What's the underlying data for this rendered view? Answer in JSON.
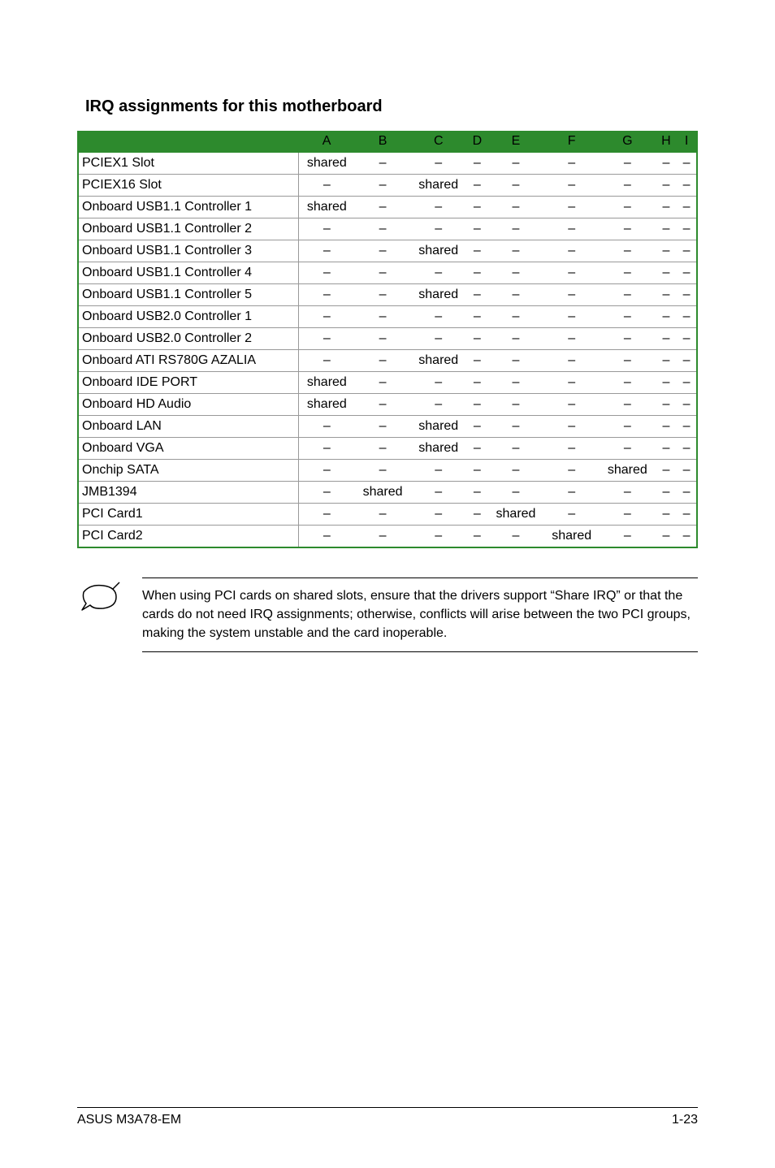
{
  "heading": "IRQ assignments for this motherboard",
  "columns": [
    "",
    "A",
    "B",
    "C",
    "D",
    "E",
    "F",
    "G",
    "H",
    "I"
  ],
  "rows": [
    {
      "label": "PCIEX1 Slot",
      "cells": [
        "shared",
        "–",
        "–",
        "–",
        "–",
        "–",
        "–",
        "–",
        "–"
      ]
    },
    {
      "label": "PCIEX16 Slot",
      "cells": [
        "–",
        "–",
        "shared",
        "–",
        "–",
        "–",
        "–",
        "–",
        "–"
      ]
    },
    {
      "label": "Onboard USB1.1 Controller 1",
      "cells": [
        "shared",
        "–",
        "–",
        "–",
        "–",
        "–",
        "–",
        "–",
        "–"
      ]
    },
    {
      "label": "Onboard USB1.1 Controller 2",
      "cells": [
        "–",
        "–",
        "–",
        "–",
        "–",
        "–",
        "–",
        "–",
        "–"
      ]
    },
    {
      "label": "Onboard USB1.1 Controller 3",
      "cells": [
        "–",
        "–",
        "shared",
        "–",
        "–",
        "–",
        "–",
        "–",
        "–"
      ]
    },
    {
      "label": "Onboard USB1.1 Controller 4",
      "cells": [
        "–",
        "–",
        "–",
        "–",
        "–",
        "–",
        "–",
        "–",
        "–"
      ]
    },
    {
      "label": "Onboard USB1.1 Controller 5",
      "cells": [
        "–",
        "–",
        "shared",
        "–",
        "–",
        "–",
        "–",
        "–",
        "–"
      ]
    },
    {
      "label": "Onboard USB2.0 Controller 1",
      "cells": [
        "–",
        "–",
        "–",
        "–",
        "–",
        "–",
        "–",
        "–",
        "–"
      ]
    },
    {
      "label": "Onboard USB2.0 Controller 2",
      "cells": [
        "–",
        "–",
        "–",
        "–",
        "–",
        "–",
        "–",
        "–",
        "–"
      ]
    },
    {
      "label": "Onboard ATI RS780G AZALIA",
      "cells": [
        "–",
        "–",
        "shared",
        "–",
        "–",
        "–",
        "–",
        "–",
        "–"
      ]
    },
    {
      "label": "Onboard  IDE  PORT",
      "cells": [
        "shared",
        "–",
        "–",
        "–",
        "–",
        "–",
        "–",
        "–",
        "–"
      ]
    },
    {
      "label": "Onboard  HD Audio",
      "cells": [
        "shared",
        "–",
        "–",
        "–",
        "–",
        "–",
        "–",
        "–",
        "–"
      ]
    },
    {
      "label": "Onboard  LAN",
      "cells": [
        "–",
        "–",
        "shared",
        "–",
        "–",
        "–",
        "–",
        "–",
        "–"
      ]
    },
    {
      "label": "Onboard  VGA",
      "cells": [
        "–",
        "–",
        "shared",
        "–",
        "–",
        "–",
        "–",
        "–",
        "–"
      ]
    },
    {
      "label": "Onchip SATA",
      "cells": [
        "–",
        "–",
        "–",
        "–",
        "–",
        "–",
        "shared",
        "–",
        "–"
      ]
    },
    {
      "label": "JMB1394",
      "cells": [
        "–",
        "shared",
        "–",
        "–",
        "–",
        "–",
        "–",
        "–",
        "–"
      ]
    },
    {
      "label": "PCI Card1",
      "cells": [
        "–",
        "–",
        "–",
        "–",
        "shared",
        "–",
        "–",
        "–",
        "–"
      ]
    },
    {
      "label": "PCI Card2",
      "cells": [
        "–",
        "–",
        "–",
        "–",
        "–",
        "shared",
        "–",
        "–",
        "–"
      ]
    }
  ],
  "note_text": "When using PCI cards on shared slots, ensure that the drivers support “Share IRQ” or that the cards do not need IRQ assignments; otherwise, conflicts will arise between the two PCI groups, making the system unstable and the card inoperable.",
  "footer_left": "ASUS M3A78-EM",
  "footer_right": "1-23"
}
